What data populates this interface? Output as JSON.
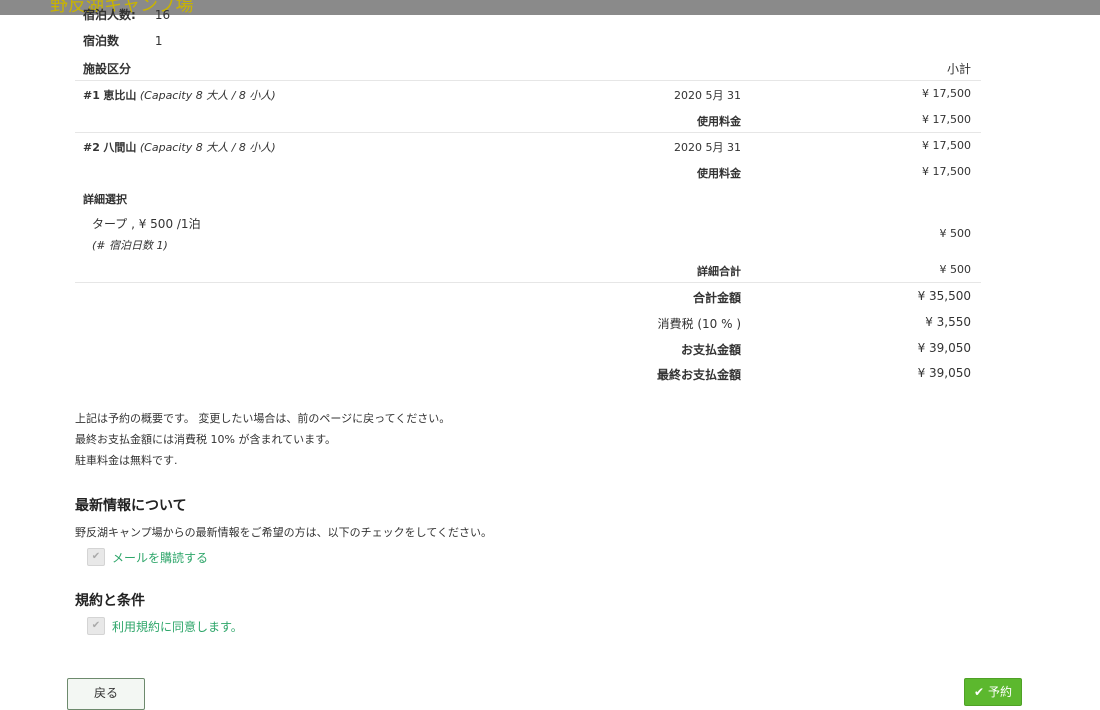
{
  "header": {
    "site_title": "野反湖キャンプ場"
  },
  "stay_info": {
    "guests_label": "宿泊人数:",
    "guests_value": "16",
    "nights_label": "宿泊数",
    "nights_value": "1"
  },
  "table": {
    "col_facility": "施設区分",
    "col_subtotal": "小計",
    "sites": [
      {
        "num": "#1",
        "name": "恵比山",
        "capacity": "(Capacity 8 大人 / 8 小人)",
        "date": "2020 5月 31",
        "amount": "¥ 17,500",
        "usage_label": "使用料金",
        "usage_amount": "¥ 17,500"
      },
      {
        "num": "#2",
        "name": "八間山",
        "capacity": "(Capacity 8 大人 / 8 小人)",
        "date": "2020 5月 31",
        "amount": "¥ 17,500",
        "usage_label": "使用料金",
        "usage_amount": "¥ 17,500"
      }
    ],
    "options_heading": "詳細選択",
    "option": {
      "name": "タープ , ¥ 500 /1泊",
      "note": "(# 宿泊日数 1)",
      "amount": "¥ 500"
    },
    "options_total_label": "詳細合計",
    "options_total_amount": "¥ 500",
    "summary": [
      {
        "label": "合計金額",
        "amount": "¥ 35,500",
        "bold": true
      },
      {
        "label": "消費税 (10 % )",
        "amount": "¥ 3,550",
        "bold": false
      },
      {
        "label": "お支払金額",
        "amount": "¥ 39,050",
        "bold": true
      },
      {
        "label": "最終お支払金額",
        "amount": "¥ 39,050",
        "bold": true
      }
    ]
  },
  "notes": [
    "上記は予約の概要です。 変更したい場合は、前のページに戻ってください。",
    "最終お支払金額には消費税 10% が含まれています。",
    "駐車料金は無料です."
  ],
  "newsletter": {
    "heading": "最新情報について",
    "description": "野反湖キャンプ場からの最新情報をご希望の方は、以下のチェックをしてください。",
    "checkbox_label": "メールを購読する"
  },
  "terms": {
    "heading": "規約と条件",
    "checkbox_label": "利用規約に同意します。"
  },
  "buttons": {
    "back": "戻る",
    "reserve": "予約"
  }
}
